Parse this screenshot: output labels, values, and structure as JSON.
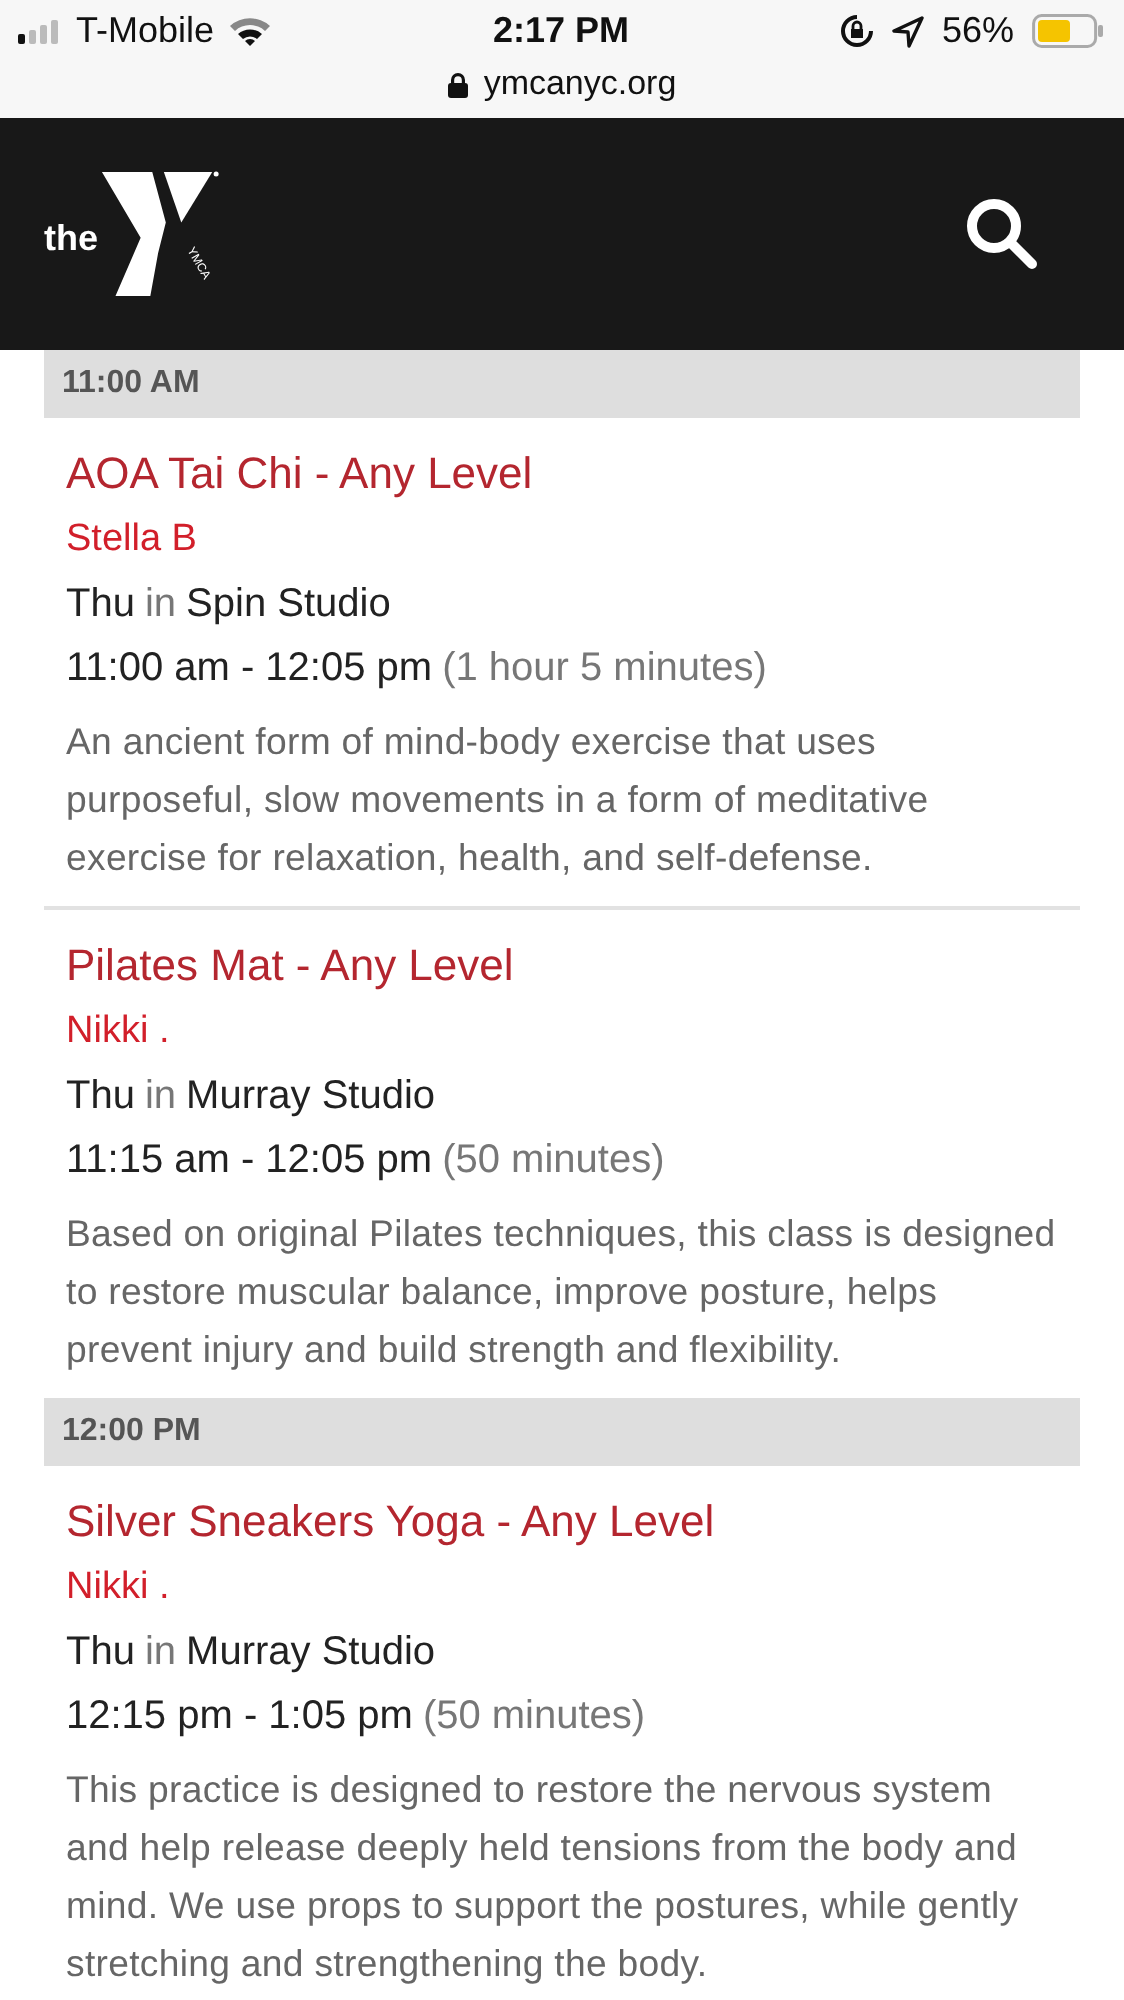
{
  "status_bar": {
    "carrier": "T-Mobile",
    "time": "2:17 PM",
    "battery": "56%"
  },
  "address_bar": {
    "url": "ymcanyc.org"
  },
  "header": {
    "logo_text": "the",
    "logo_subtext": "YMCA"
  },
  "sessions": [
    {
      "heading": "11:00 AM",
      "classes": [
        {
          "title": "AOA Tai Chi - Any Level",
          "instructor": "Stella B",
          "day": "Thu",
          "joiner": "in",
          "room": "Spin Studio",
          "time": "11:00 am - 12:05 pm",
          "duration": "(1 hour 5 minutes)",
          "description": "An ancient form of mind-body exercise that uses purposeful, slow movements in a form of meditative exercise for relaxation, health, and self-defense."
        },
        {
          "title": "Pilates Mat - Any Level",
          "instructor": "Nikki .",
          "day": "Thu",
          "joiner": "in",
          "room": "Murray Studio",
          "time": "11:15 am - 12:05 pm",
          "duration": "(50 minutes)",
          "description": "Based on original Pilates techniques, this class is designed to restore muscular balance, improve posture, helps prevent injury and build strength and flexibility."
        }
      ]
    },
    {
      "heading": "12:00 PM",
      "classes": [
        {
          "title": "Silver Sneakers Yoga - Any Level",
          "instructor": "Nikki .",
          "day": "Thu",
          "joiner": "in",
          "room": "Murray Studio",
          "time": "12:15 pm - 1:05 pm",
          "duration": "(50 minutes)",
          "description": "This practice is designed to restore the nervous system and help release deeply held tensions from the body and mind. We use props to support the postures, while gently stretching and strengthening the body."
        }
      ]
    }
  ]
}
